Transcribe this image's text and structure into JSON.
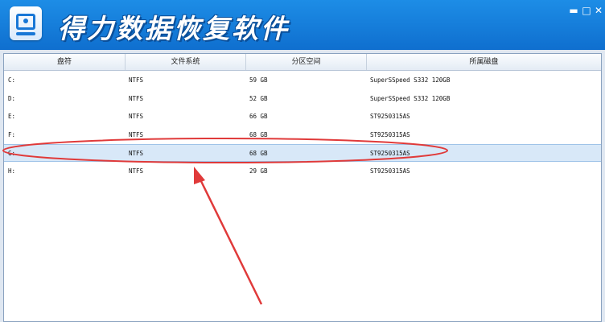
{
  "window": {
    "title": "得力数据恢复软件",
    "minimize_glyph": "▬",
    "maximize_glyph": "□",
    "close_glyph": "✕"
  },
  "table": {
    "columns": [
      "盘符",
      "文件系统",
      "分区空间",
      "所属磁盘"
    ],
    "rows": [
      {
        "drive": "C:",
        "fs": "NTFS",
        "size": "59 GB",
        "disk": "SuperSSpeed S332 120GB"
      },
      {
        "drive": "D:",
        "fs": "NTFS",
        "size": "52 GB",
        "disk": "SuperSSpeed S332 120GB"
      },
      {
        "drive": "E:",
        "fs": "NTFS",
        "size": "66 GB",
        "disk": "ST9250315AS"
      },
      {
        "drive": "F:",
        "fs": "NTFS",
        "size": "68 GB",
        "disk": "ST9250315AS"
      },
      {
        "drive": "G:",
        "fs": "NTFS",
        "size": "68 GB",
        "disk": "ST9250315AS"
      },
      {
        "drive": "H:",
        "fs": "NTFS",
        "size": "29 GB",
        "disk": "ST9250315AS"
      }
    ],
    "selected_row": 4
  },
  "annotation": {
    "color": "#e03a3a"
  }
}
